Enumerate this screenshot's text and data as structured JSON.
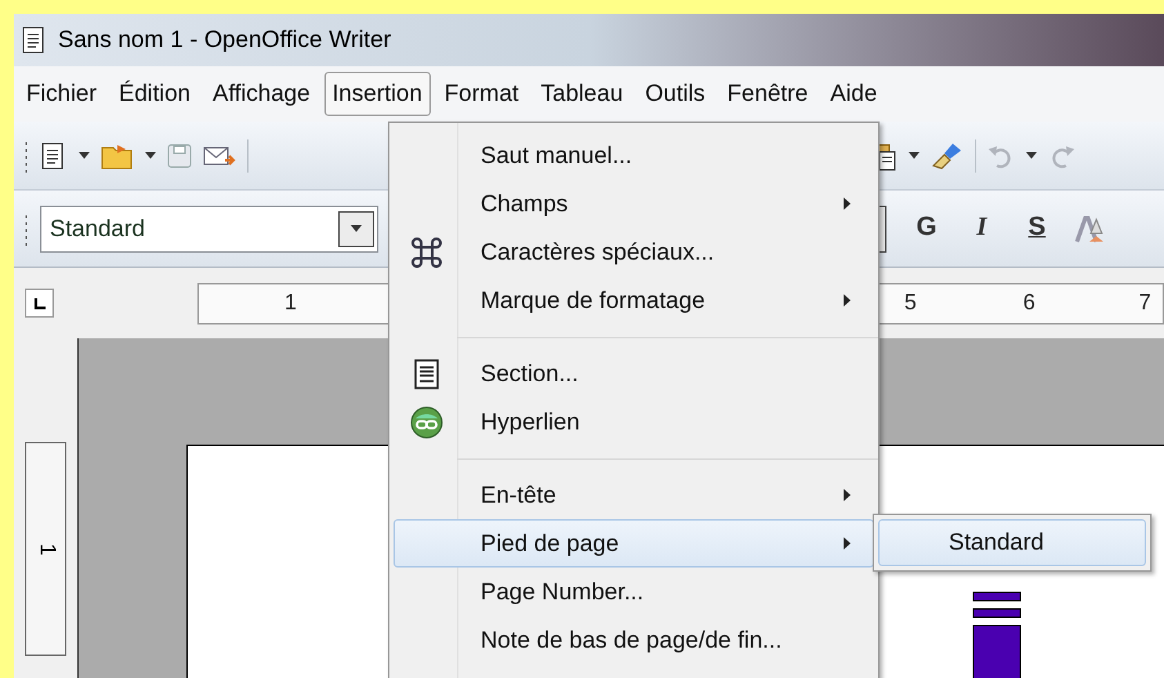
{
  "window": {
    "title": "Sans nom 1 - OpenOffice Writer"
  },
  "menu_bar": [
    {
      "label": "Fichier",
      "selected": false
    },
    {
      "label": "Édition",
      "selected": false
    },
    {
      "label": "Affichage",
      "selected": false
    },
    {
      "label": "Insertion",
      "selected": true
    },
    {
      "label": "Format",
      "selected": false
    },
    {
      "label": "Tableau",
      "selected": false
    },
    {
      "label": "Outils",
      "selected": false
    },
    {
      "label": "Fenêtre",
      "selected": false
    },
    {
      "label": "Aide",
      "selected": false
    }
  ],
  "formatting": {
    "style_box": {
      "value": "Standard"
    },
    "buttons": [
      "G",
      "I",
      "S"
    ]
  },
  "ruler": {
    "labels": [
      "1",
      "5",
      "6",
      "7"
    ]
  },
  "vertical_ruler": {
    "label": "1"
  },
  "menu": {
    "items": [
      {
        "kind": "item",
        "label": "Saut manuel...",
        "submenu": false,
        "selected": false
      },
      {
        "kind": "item",
        "label": "Champs",
        "submenu": true,
        "selected": false
      },
      {
        "kind": "item",
        "label": "Caractères spéciaux...",
        "submenu": false,
        "selected": false
      },
      {
        "kind": "item",
        "label": "Marque de formatage",
        "submenu": true,
        "selected": false
      },
      {
        "kind": "separator"
      },
      {
        "kind": "item",
        "label": "Section...",
        "submenu": false,
        "selected": false
      },
      {
        "kind": "item",
        "label": "Hyperlien",
        "submenu": false,
        "selected": false
      },
      {
        "kind": "separator"
      },
      {
        "kind": "item",
        "label": "En-tête",
        "submenu": true,
        "selected": false
      },
      {
        "kind": "item",
        "label": "Pied de page",
        "submenu": true,
        "selected": true
      },
      {
        "kind": "item",
        "label": "Page Number...",
        "submenu": false,
        "selected": false
      },
      {
        "kind": "item",
        "label": "Note de bas de page/de fin...",
        "submenu": false,
        "selected": false
      }
    ]
  },
  "submenu": {
    "items": [
      {
        "label": "Standard",
        "selected": true
      }
    ]
  }
}
